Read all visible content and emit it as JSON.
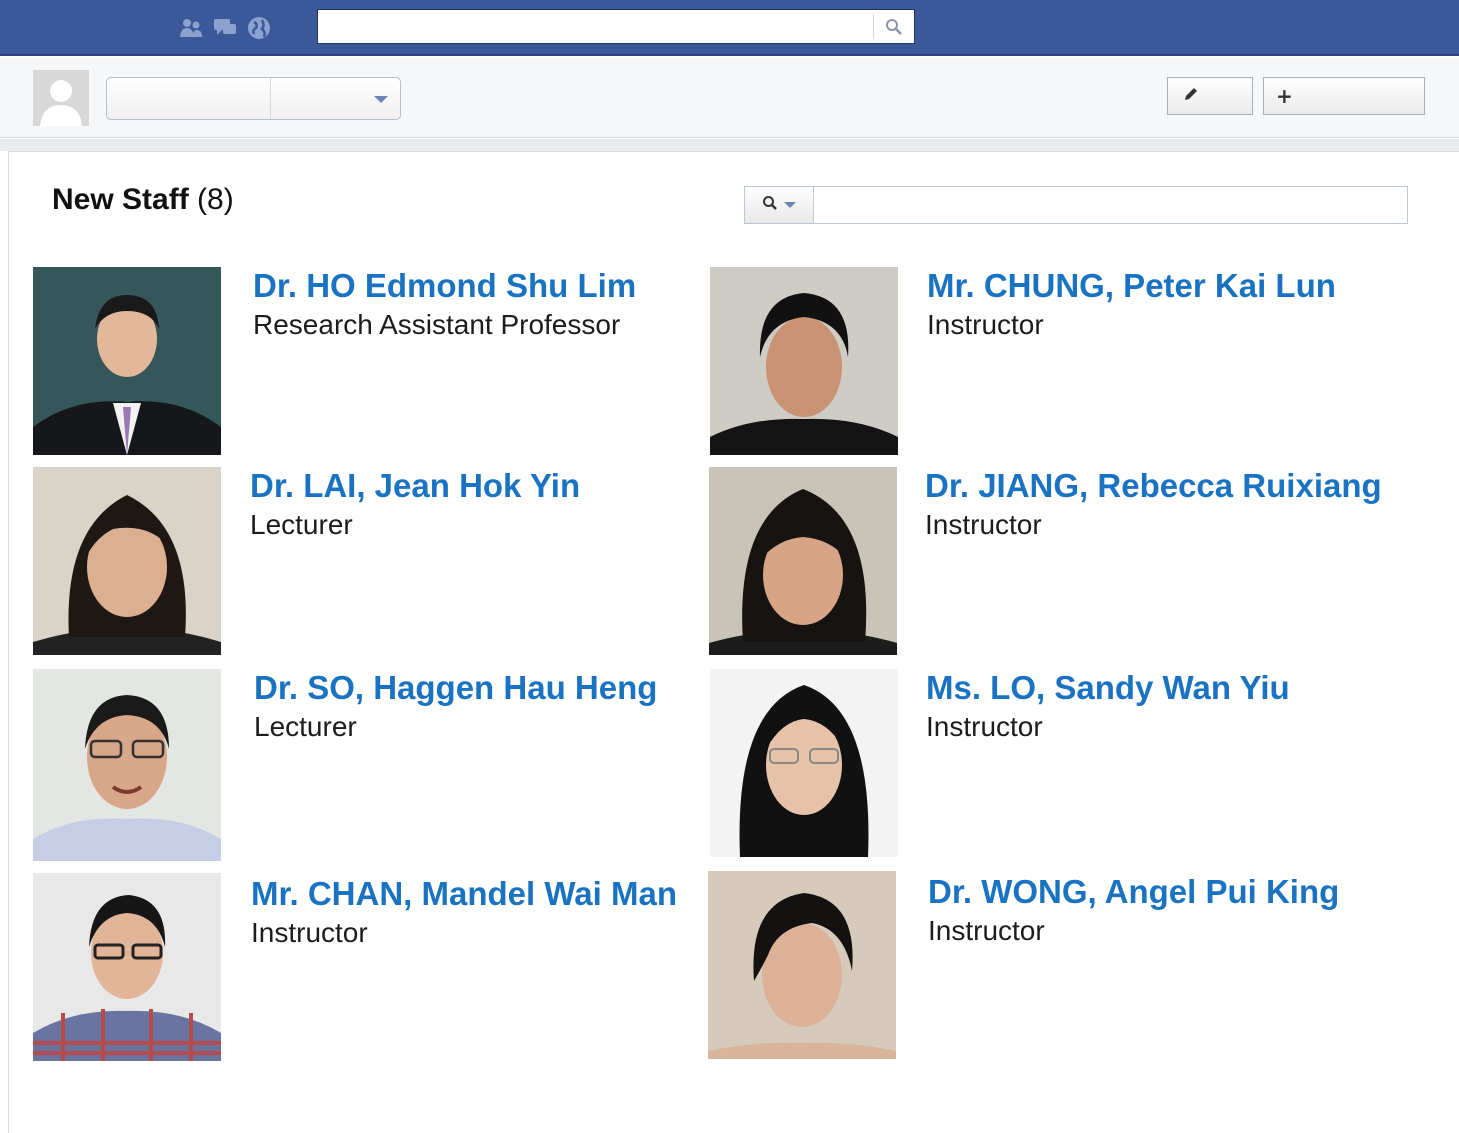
{
  "topbar": {
    "icons": [
      "friends-icon",
      "messages-icon",
      "globe-icon",
      "search-icon"
    ],
    "search_value": ""
  },
  "toolbar": {
    "select_value": "",
    "edit_icon": "pencil-icon",
    "add_label": "+"
  },
  "section": {
    "title": "New Staff",
    "count": "(8)",
    "filter_value": ""
  },
  "staff": [
    {
      "name": "Dr. HO Edmond Shu Lim",
      "role": "Research Assistant Professor"
    },
    {
      "name": "Mr. CHUNG, Peter Kai Lun",
      "role": "Instructor"
    },
    {
      "name": "Dr. LAI, Jean Hok Yin",
      "role": "Lecturer"
    },
    {
      "name": "Dr. JIANG, Rebecca Ruixiang",
      "role": "Instructor"
    },
    {
      "name": "Dr. SO, Haggen Hau Heng",
      "role": "Lecturer"
    },
    {
      "name": "Ms. LO, Sandy Wan Yiu",
      "role": "Instructor"
    },
    {
      "name": "Mr. CHAN, Mandel Wai Man",
      "role": "Instructor"
    },
    {
      "name": "Dr. WONG, Angel Pui King",
      "role": "Instructor"
    }
  ],
  "colors": {
    "topbar": "#3b5998",
    "link": "#1a73c2"
  }
}
